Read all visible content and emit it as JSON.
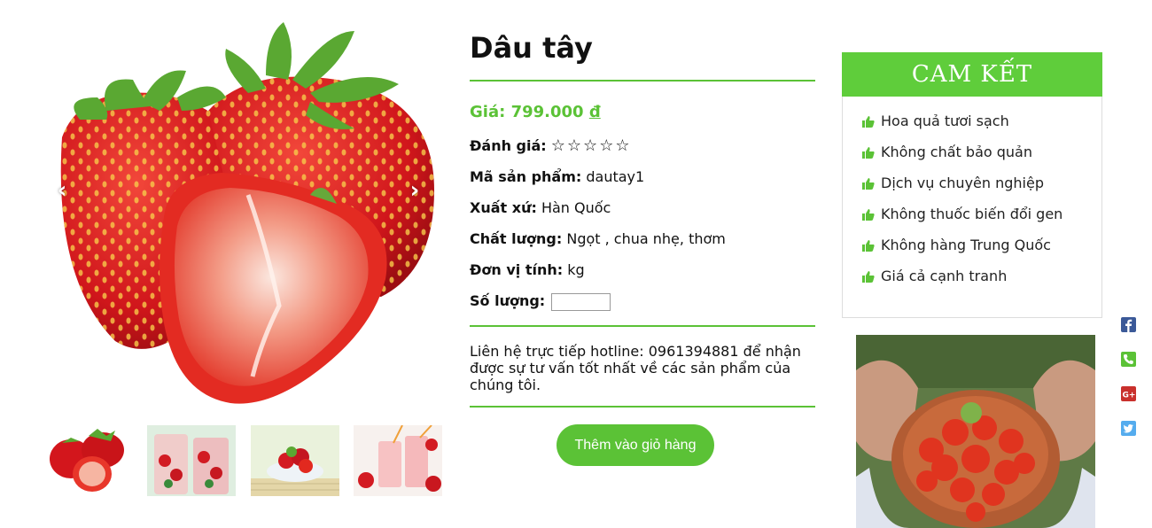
{
  "gallery": {
    "prev_arrow": "‹",
    "next_arrow": "›",
    "thumbnails": [
      "strawberry-halves",
      "strawberry-drink-cups",
      "strawberry-bowl",
      "strawberry-smoothie"
    ]
  },
  "product": {
    "title": "Dâu tây",
    "price_label": "Giá:",
    "price_value": "799.000",
    "price_currency": "đ",
    "rating_label": "Đánh giá:",
    "rating_stars": "☆☆☆☆☆",
    "rating_value": 0,
    "sku_label": "Mã sản phẩm:",
    "sku_value": "dautay1",
    "origin_label": "Xuất xứ:",
    "origin_value": "Hàn Quốc",
    "quality_label": "Chất lượng:",
    "quality_value": "Ngọt , chua nhẹ, thơm",
    "unit_label": "Đơn vị tính:",
    "unit_value": "kg",
    "quantity_label": "Số lượng:",
    "quantity_value": "",
    "contact_text": "Liên hệ trực tiếp hotline: 0961394881 để nhận được sự tư vấn tốt nhất về các sản phẩm của chúng tôi.",
    "add_to_cart_label": "Thêm vào giỏ hàng"
  },
  "commitments": {
    "title": "CAM KẾT",
    "items": [
      "Hoa quả tươi sạch",
      "Không chất bảo quản",
      "Dịch vụ chuyên nghiệp",
      "Không thuốc biến đổi gen",
      "Không hàng Trung Quốc",
      "Giá cả cạnh tranh"
    ]
  },
  "social": [
    "facebook-icon",
    "phone-icon",
    "google-plus-icon",
    "twitter-icon"
  ],
  "colors": {
    "accent": "#5bc236",
    "header": "#5fcd3b",
    "facebook": "#3b5998",
    "phone": "#5bc236",
    "google_plus": "#c9302c",
    "twitter": "#55acee"
  }
}
